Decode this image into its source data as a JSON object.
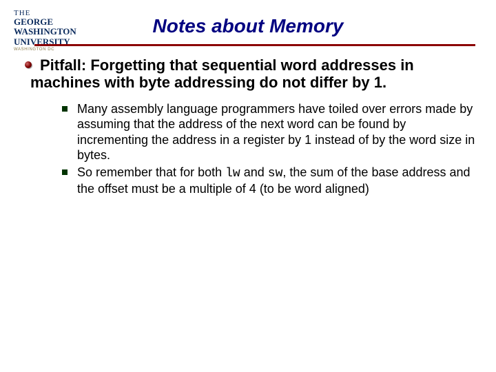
{
  "logo": {
    "line1": "THE",
    "line2": "GEORGE",
    "line3": "WASHINGTON",
    "line4": "UNIVERSITY",
    "tag": "WASHINGTON DC"
  },
  "title": "Notes about Memory",
  "pitfall_label": "Pitfall:",
  "pitfall_rest": " Forgetting that sequential word addresses in machines with byte addressing do not differ by 1.",
  "sub1": "Many assembly language programmers have toiled over errors made by assuming that the address of the next word can be found by incrementing the address in a register by 1 instead of by the word size in bytes.",
  "sub2_a": "So remember that for both ",
  "sub2_code1": "lw",
  "sub2_b": " and ",
  "sub2_code2": "sw",
  "sub2_c": ", the sum of the base address and the offset must be a multiple of 4 (to be word aligned)"
}
